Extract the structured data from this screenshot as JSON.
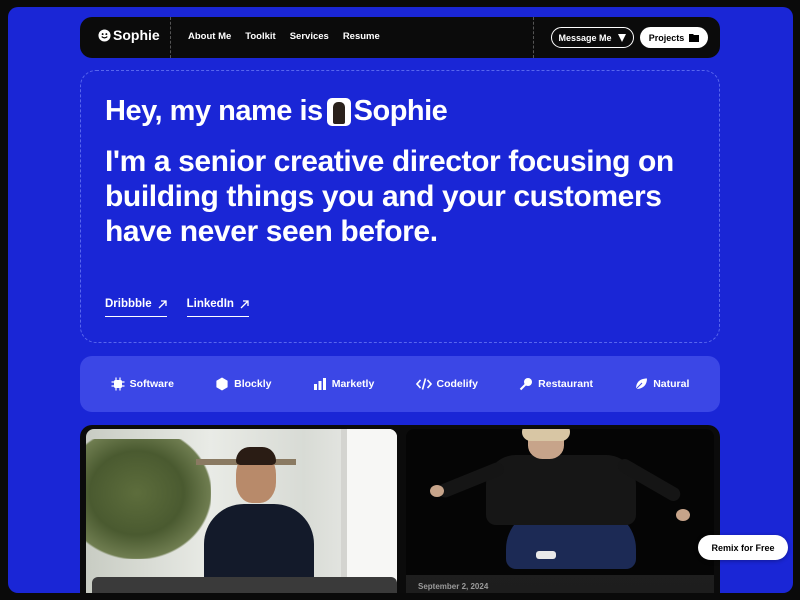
{
  "nav": {
    "brand": "Sophie",
    "links": [
      "About Me",
      "Toolkit",
      "Services",
      "Resume"
    ],
    "message_label": "Message Me",
    "projects_label": "Projects"
  },
  "hero": {
    "greeting_prefix": "Hey, my name is",
    "greeting_name": "Sophie",
    "headline": "I'm a senior creative director focusing on building things you and your customers have never seen before.",
    "links": [
      "Dribbble",
      "LinkedIn"
    ]
  },
  "logos": [
    {
      "label": "Software",
      "icon": "chip-icon"
    },
    {
      "label": "Blockly",
      "icon": "hexagon-icon"
    },
    {
      "label": "Marketly",
      "icon": "bar-chart-icon"
    },
    {
      "label": "Codelify",
      "icon": "code-icon"
    },
    {
      "label": "Restaurant",
      "icon": "spoon-icon"
    },
    {
      "label": "Natural",
      "icon": "leaf-icon"
    }
  ],
  "projects": [
    {
      "date": ""
    },
    {
      "date": "September 2, 2024"
    }
  ],
  "remix_label": "Remix for Free",
  "colors": {
    "accent": "#1a26d6",
    "logo_strip": "#3b47e6",
    "dark": "#0b0b0b"
  }
}
